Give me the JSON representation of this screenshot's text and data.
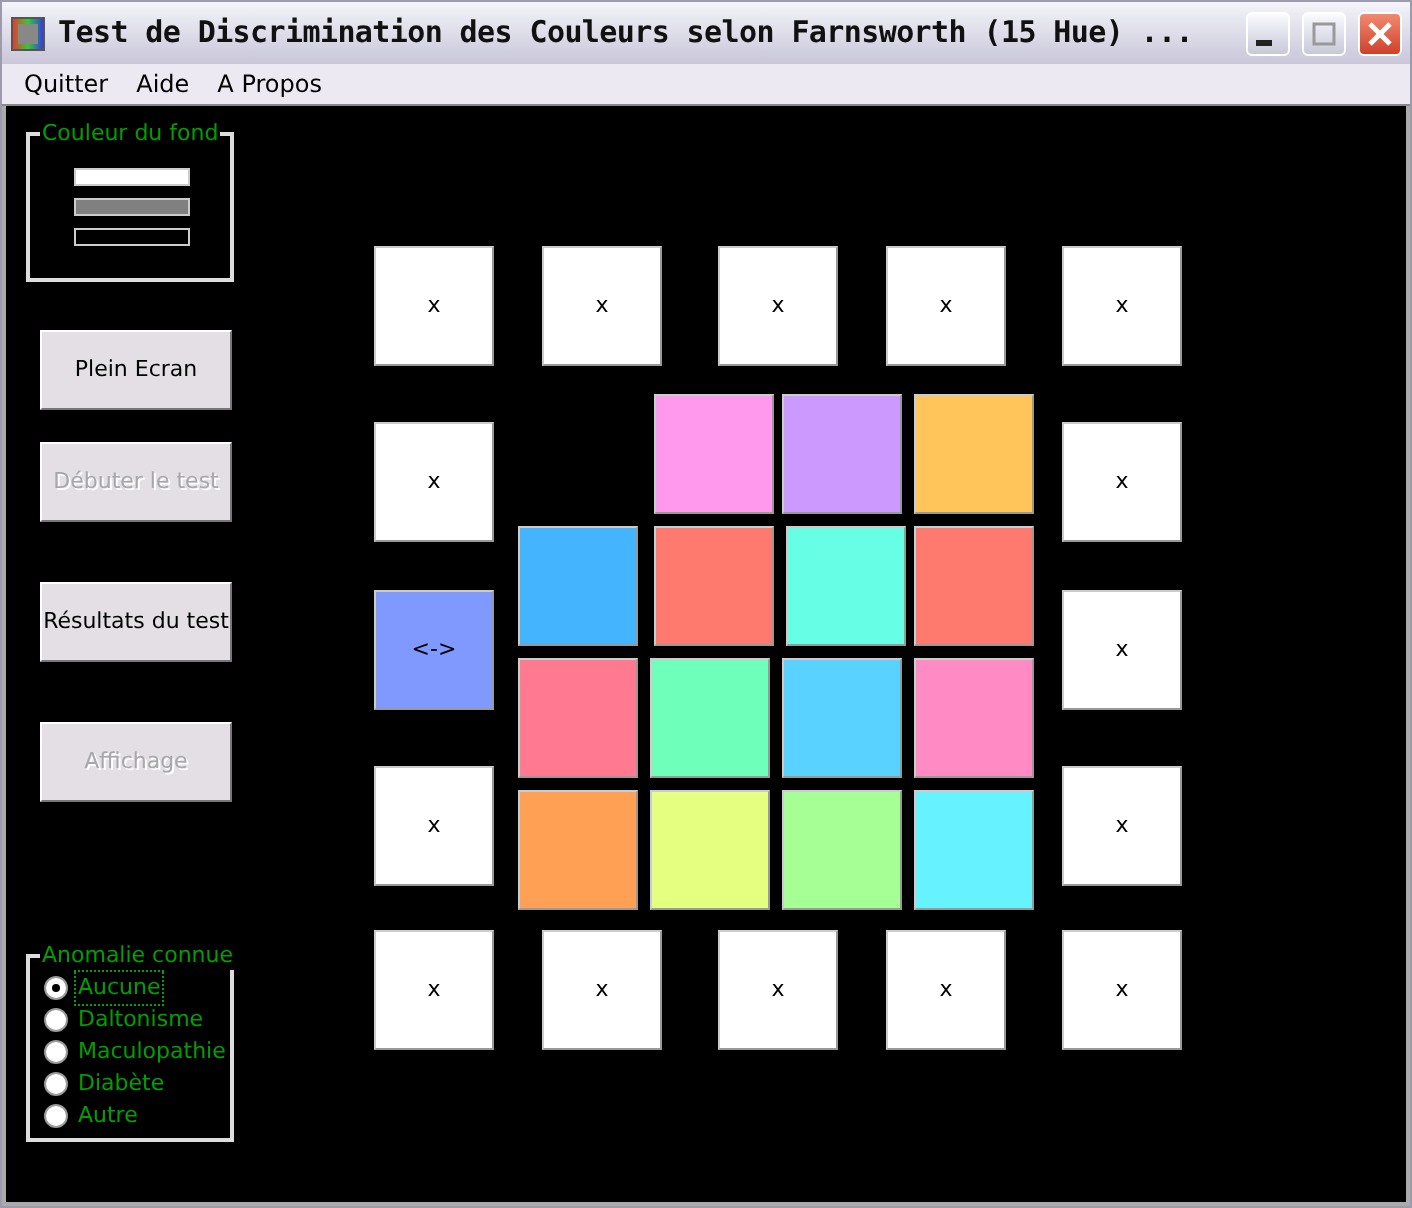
{
  "window": {
    "title": "Test de Discrimination des Couleurs selon Farnsworth (15 Hue) ..."
  },
  "menu": [
    "Quitter",
    "Aide",
    "A Propos"
  ],
  "background_group": {
    "label": "Couleur du fond",
    "options": [
      {
        "color": "#ffffff"
      },
      {
        "color": "#808080"
      },
      {
        "color": "#000000"
      }
    ]
  },
  "buttons": [
    {
      "label": "Plein Ecran",
      "disabled": false
    },
    {
      "label": "Débuter le test",
      "disabled": true
    },
    {
      "label": "Résultats du test",
      "disabled": false
    },
    {
      "label": "Affichage",
      "disabled": true
    }
  ],
  "anomaly_group": {
    "label": "Anomalie connue",
    "options": [
      {
        "label": "Aucune",
        "selected": true
      },
      {
        "label": "Daltonisme",
        "selected": false
      },
      {
        "label": "Maculopathie",
        "selected": false
      },
      {
        "label": "Diabète",
        "selected": false
      },
      {
        "label": "Autre",
        "selected": false
      }
    ]
  },
  "slots": [
    {
      "label": "x",
      "color": "#ffffff"
    },
    {
      "label": "x",
      "color": "#ffffff"
    },
    {
      "label": "x",
      "color": "#ffffff"
    },
    {
      "label": "x",
      "color": "#ffffff"
    },
    {
      "label": "x",
      "color": "#ffffff"
    },
    {
      "label": "x",
      "color": "#ffffff"
    },
    {
      "label": "x",
      "color": "#ffffff"
    },
    {
      "label": "<->",
      "color": "#7f99ff"
    },
    {
      "label": "x",
      "color": "#ffffff"
    },
    {
      "label": "x",
      "color": "#ffffff"
    },
    {
      "label": "x",
      "color": "#ffffff"
    },
    {
      "label": "x",
      "color": "#ffffff"
    },
    {
      "label": "x",
      "color": "#ffffff"
    },
    {
      "label": "x",
      "color": "#ffffff"
    },
    {
      "label": "x",
      "color": "#ffffff"
    },
    {
      "label": "x",
      "color": "#ffffff"
    }
  ],
  "caps": [
    {
      "color": "#ff99ee"
    },
    {
      "color": "#cc99ff"
    },
    {
      "color": "#ffc55a"
    },
    {
      "color": "#44b4ff"
    },
    {
      "color": "#ff7a6e"
    },
    {
      "color": "#66ffe6"
    },
    {
      "color": "#ff7a6e"
    },
    {
      "color": "#ff7a91"
    },
    {
      "color": "#6effbb"
    },
    {
      "color": "#5ad2ff"
    },
    {
      "color": "#ff8ac4"
    },
    {
      "color": "#ffa055"
    },
    {
      "color": "#e5ff80"
    },
    {
      "color": "#a6ff94"
    },
    {
      "color": "#66f2ff"
    }
  ]
}
